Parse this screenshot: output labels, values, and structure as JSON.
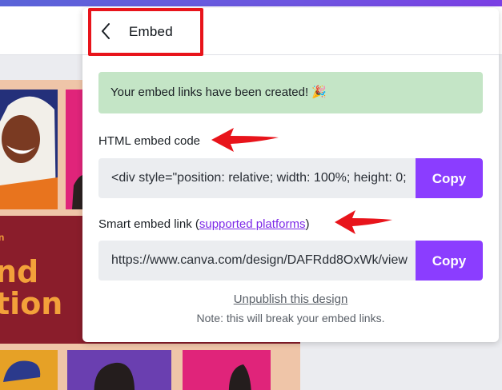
{
  "panel": {
    "title": "Embed",
    "success_message": "Your embed links have been created! 🎉",
    "html_label": "HTML embed code",
    "html_value": "<div style=\"position: relative; width: 100%; height: 0;",
    "smart_label_prefix": "Smart embed link (",
    "smart_label_link": "supported platforms",
    "smart_label_suffix": ")",
    "smart_value": "https://www.canva.com/design/DAFRdd8OxWk/view",
    "copy_label": "Copy",
    "unpublish_label": "Unpublish this design",
    "note": "Note: this will break your embed links."
  },
  "background": {
    "banner_small": "n",
    "banner_line1": "nd",
    "banner_line2": "tion"
  },
  "colors": {
    "accent": "#8b3dff",
    "success_bg": "#c4e5c6",
    "annotation_red": "#e8141b"
  }
}
